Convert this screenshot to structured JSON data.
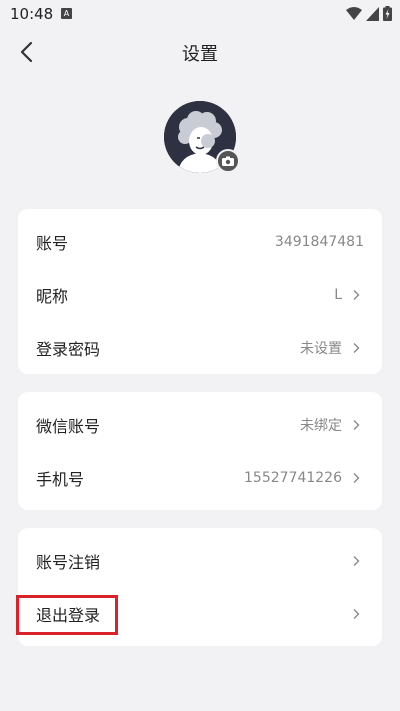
{
  "status_bar": {
    "time": "10:48",
    "notif_letter": "A",
    "icons": [
      "wifi-icon",
      "signal-icon",
      "battery-charging-icon"
    ]
  },
  "nav": {
    "title": "设置",
    "back_icon": "chevron-left-icon"
  },
  "avatar": {
    "badge_icon": "camera-icon"
  },
  "groups": [
    {
      "rows": [
        {
          "label": "账号",
          "value": "3491847481",
          "arrow": false
        },
        {
          "label": "昵称",
          "value": "L",
          "arrow": true
        },
        {
          "label": "登录密码",
          "value": "未设置",
          "arrow": true
        }
      ]
    },
    {
      "rows": [
        {
          "label": "微信账号",
          "value": "未绑定",
          "arrow": true
        },
        {
          "label": "手机号",
          "value": "15527741226",
          "arrow": true
        }
      ]
    },
    {
      "rows": [
        {
          "label": "账号注销",
          "value": "",
          "arrow": true
        },
        {
          "label": "退出登录",
          "value": "",
          "arrow": true
        }
      ]
    }
  ],
  "colors": {
    "background": "#f2f2f4",
    "card": "#ffffff",
    "highlight": "#d8232a",
    "avatar_bg": "#2d3142"
  }
}
